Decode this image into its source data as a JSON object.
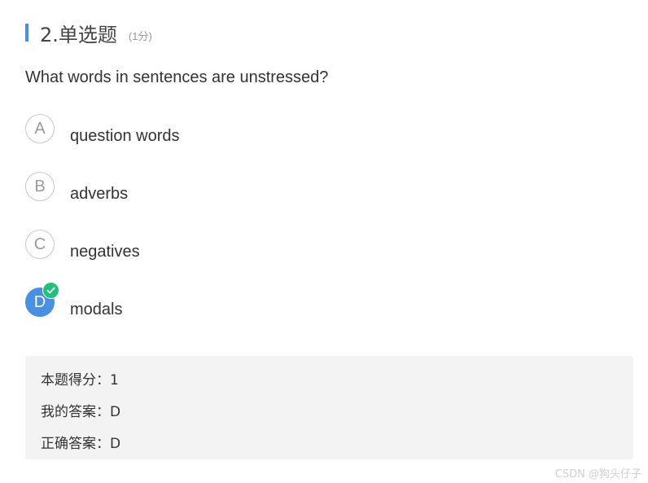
{
  "question": {
    "title": "2.单选题",
    "score_note": "(1分)",
    "text": "What words in sentences are unstressed?"
  },
  "options": [
    {
      "letter": "A",
      "text": "question words",
      "selected": false
    },
    {
      "letter": "B",
      "text": "adverbs",
      "selected": false
    },
    {
      "letter": "C",
      "text": "negatives",
      "selected": false
    },
    {
      "letter": "D",
      "text": "modals",
      "selected": true,
      "correct_icon": "check-icon"
    }
  ],
  "result": {
    "score_line": "本题得分：1",
    "my_answer_line": "我的答案：D",
    "correct_answer_line": "正确答案：D"
  },
  "watermark": "CSDN @狗头仔子",
  "colors": {
    "accent_blue": "#4a90e2",
    "correct_green": "#22c07a",
    "result_bg": "#f3f3f3"
  }
}
